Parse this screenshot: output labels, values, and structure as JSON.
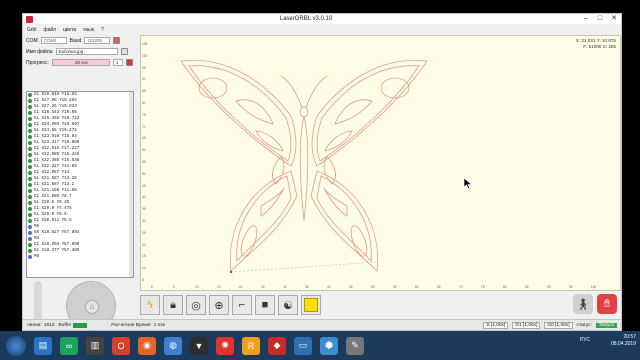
{
  "window": {
    "title": "LaserGRBL v3.0.10",
    "minimize": "–",
    "maximize": "□",
    "close": "✕"
  },
  "menu": [
    "Grbl",
    "файл",
    "цвета",
    "язык",
    "?"
  ],
  "connection": {
    "com_label": "COM",
    "com_value": "COM4",
    "baud_label": "Baud",
    "baud_value": "115200"
  },
  "file": {
    "label": "Имя файла",
    "value": "Бабочка.jpg"
  },
  "progress": {
    "label": "Прогресс:",
    "value": "40 sec",
    "copies": "1"
  },
  "gcode_lines": [
    "G1 X28.045 Y16.93",
    "G1 X27.95 Y19.294",
    "G1 X27.25 Y19.033",
    "G1 X26.543 Y19.68",
    "G1 X25.456 Y19.722",
    "G1 X24.903 Y19.697",
    "G1 X24.55 Y19.272",
    "G1 X23.916 Y18.64",
    "G1 X23.317 Y18.009",
    "G1 X22.915 Y17.227",
    "G1 X22.985 Y16.426",
    "G1 X22.365 Y15.538",
    "G1 X22.327 Y14.65",
    "G1 X22.067 Y14",
    "G1 X21.587 Y13.28",
    "G1 X21.587 Y12.2",
    "G1 X21.106 Y11.86",
    "G1 X21.085 Y8.7",
    "G1 X20.6 Y8.35",
    "G1 X20.9 Y7.475",
    "G1 X20.9 Y6.6",
    "G1 X20.911 Y5.6",
    "M5",
    "G0 X18.827 Y57.894",
    "M3",
    "G1 X18.904 Y57.898",
    "G1 X18.377 Y57.389",
    "M5"
  ],
  "canvas": {
    "coords_line1": "X: 21.031 Y: 10.075",
    "coords_line2": "F: 51000 S: 255",
    "y_ticks": [
      "105",
      "100",
      "95",
      "90",
      "85",
      "80",
      "75",
      "70",
      "65",
      "60",
      "55",
      "50",
      "45",
      "40",
      "35",
      "30",
      "25",
      "20",
      "15",
      "10",
      "5"
    ],
    "x_ticks": [
      "0",
      "5",
      "10",
      "15",
      "20",
      "25",
      "30",
      "35",
      "40",
      "45",
      "50",
      "55",
      "60",
      "65",
      "70",
      "75",
      "80",
      "85",
      "90",
      "95",
      "100"
    ]
  },
  "statusbar": {
    "lines_label": "линии:",
    "lines_value": "1812",
    "buffer_label": "Buffer",
    "time_label": "Расчетное Время:",
    "time_value": "1 min",
    "s_value": "S [1,00x]",
    "g1_value": "G1 [1,00x]",
    "g0_value": "G0 [1,00x]",
    "status_label": "статус:",
    "status_value": "Запуск"
  },
  "taskbar": {
    "lang": "РУС",
    "time": "20:57",
    "date": "08.04.2019"
  },
  "colors": {
    "canvas_bg": "#fffde7",
    "path": "#e39a86",
    "status_green": "#2ea84a"
  }
}
